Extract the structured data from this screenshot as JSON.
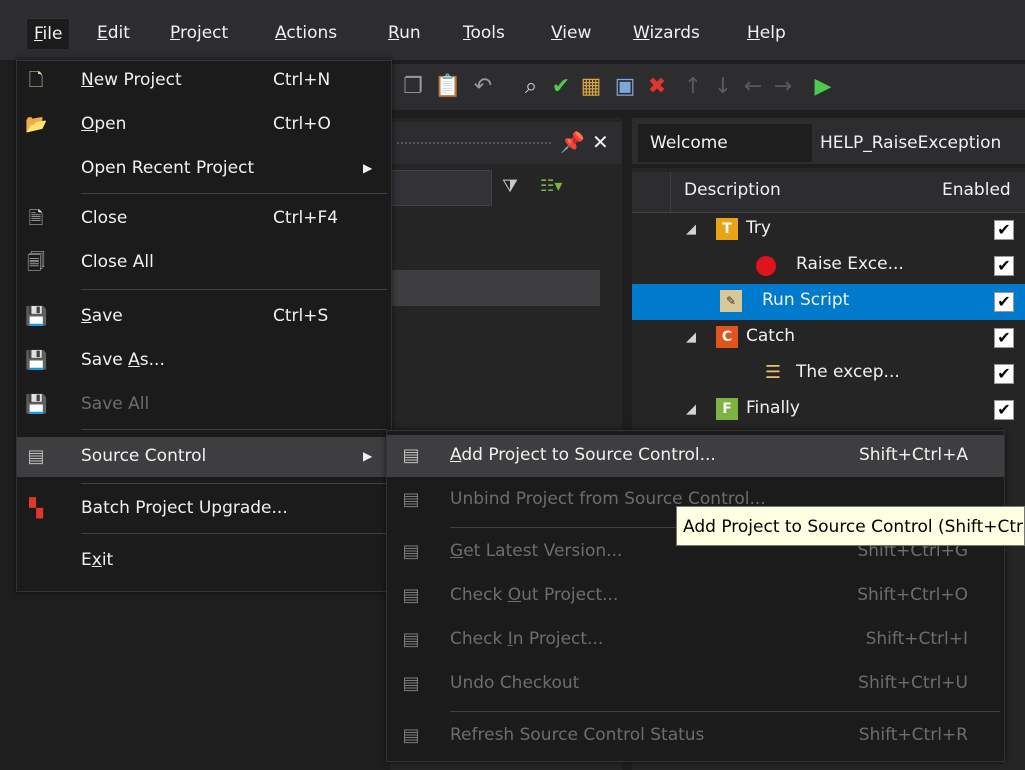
{
  "menubar": {
    "items": [
      {
        "pre": "",
        "u": "F",
        "post": "ile"
      },
      {
        "pre": "",
        "u": "E",
        "post": "dit"
      },
      {
        "pre": "",
        "u": "P",
        "post": "roject"
      },
      {
        "pre": "",
        "u": "A",
        "post": "ctions"
      },
      {
        "pre": "",
        "u": "R",
        "post": "un"
      },
      {
        "pre": "",
        "u": "T",
        "post": "ools"
      },
      {
        "pre": "",
        "u": "V",
        "post": "iew"
      },
      {
        "pre": "",
        "u": "W",
        "post": "izards"
      },
      {
        "pre": "",
        "u": "H",
        "post": "elp"
      }
    ]
  },
  "file_menu": {
    "new_project": {
      "pre": "",
      "u": "N",
      "post": "ew Project",
      "shortcut": "Ctrl+N"
    },
    "open": {
      "pre": "",
      "u": "O",
      "post": "pen",
      "shortcut": "Ctrl+O"
    },
    "open_recent": {
      "label": "Open Recent Project"
    },
    "close": {
      "label": "Close",
      "shortcut": "Ctrl+F4"
    },
    "close_all": {
      "label": "Close All"
    },
    "save": {
      "pre": "",
      "u": "S",
      "post": "ave",
      "shortcut": "Ctrl+S"
    },
    "save_as": {
      "pre": "Save ",
      "u": "A",
      "post": "s..."
    },
    "save_all": {
      "label": "Save All"
    },
    "source_control": {
      "label": "Source Control"
    },
    "batch_upgrade": {
      "label": "Batch Project Upgrade..."
    },
    "exit": {
      "pre": "E",
      "u": "x",
      "post": "it"
    }
  },
  "source_control_menu": {
    "add": {
      "pre": "",
      "u": "A",
      "post": "dd Project to Source Control...",
      "shortcut": "Shift+Ctrl+A"
    },
    "unbind": {
      "label": "Unbind Project from Source Control..."
    },
    "get_latest": {
      "pre": "",
      "u": "G",
      "post": "et Latest Version...",
      "shortcut": "Shift+Ctrl+G"
    },
    "check_out": {
      "pre": "Check ",
      "u": "O",
      "post": "ut Project...",
      "shortcut": "Shift+Ctrl+O"
    },
    "check_in": {
      "pre": "Check ",
      "u": "I",
      "post": "n Project...",
      "shortcut": "Shift+Ctrl+I"
    },
    "undo": {
      "label": "Undo Checkout",
      "shortcut": "Shift+Ctrl+U"
    },
    "refresh": {
      "label": "Refresh Source Control Status",
      "shortcut": "Shift+Ctrl+R"
    }
  },
  "tooltip": {
    "text": "Add Project to Source Control (Shift+Ctrl+A)"
  },
  "tabs": [
    {
      "label": "Welcome"
    },
    {
      "label": "HELP_RaiseException"
    }
  ],
  "grid": {
    "headers": {
      "description": "Description",
      "enabled": "Enabled"
    },
    "rows": [
      {
        "label": "Try",
        "icon": "T",
        "color": "#e8a317"
      },
      {
        "label": "Raise Exce...",
        "icon": "raise-exception-icon"
      },
      {
        "label": "Run Script",
        "icon": "script-icon"
      },
      {
        "label": "Catch",
        "icon": "C",
        "color": "#e2541c"
      },
      {
        "label": "The excep...",
        "icon": "log-icon"
      },
      {
        "label": "Finally",
        "icon": "F",
        "color": "#7cb342"
      }
    ]
  },
  "colors": {
    "accent": "#007acc",
    "menu_bg": "#1b1b1c",
    "highlight": "#3e3e40",
    "tooltip_bg": "#ffffe1"
  }
}
